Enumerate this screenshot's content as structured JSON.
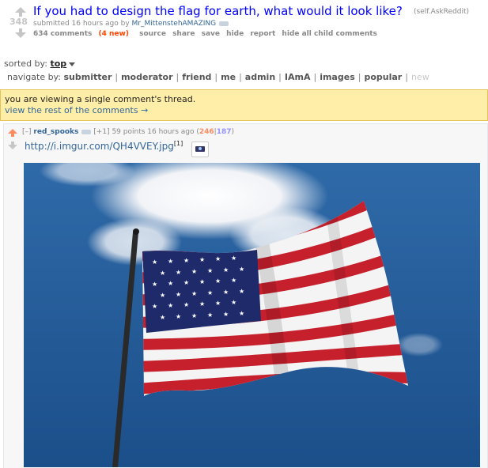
{
  "post": {
    "score": "348",
    "title": "If you had to design the flag for earth, what would it look like?",
    "domain": "(self.AskReddit)",
    "submitted_prefix": "submitted 16 hours ago by",
    "author": "Mr_MittenstehAMAZING",
    "comments_label": "634 comments",
    "new_label": "(4 new)",
    "actions": [
      "source",
      "share",
      "save",
      "hide",
      "report",
      "hide all child comments"
    ]
  },
  "sort": {
    "label": "sorted by:",
    "value": "top"
  },
  "navigate": {
    "label": "navigate by:",
    "items": [
      "submitter",
      "moderator",
      "friend",
      "me",
      "admin",
      "IAmA",
      "images",
      "popular"
    ],
    "disabled_item": "new"
  },
  "thread_banner": {
    "line1": "you are viewing a single comment's thread.",
    "line2": "view the rest of the comments →"
  },
  "comment": {
    "collapse": "[–]",
    "author": "red_spooks",
    "plus": "[+1]",
    "points": "59 points 16 hours ago",
    "paren_open": "(",
    "ups": "246",
    "divider": "|",
    "downs": "187",
    "paren_close": ")",
    "link": "http://i.imgur.com/QH4VVEY.jpg",
    "footnote": "[1]"
  },
  "colors": {
    "link_blue": "#0000ff",
    "accent_orange": "#ff4500",
    "banner_yellow": "#ffeea8",
    "upvote": "#ff8b60",
    "downvote": "#9494ff"
  },
  "icons": [
    "upvote-arrow-icon",
    "downvote-arrow-icon",
    "camera-icon",
    "dropdown-caret-icon"
  ]
}
